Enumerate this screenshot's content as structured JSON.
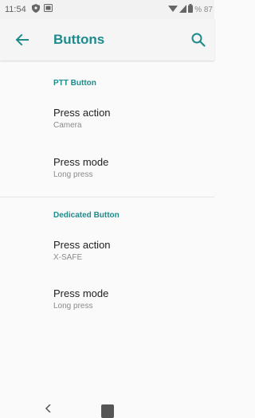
{
  "status": {
    "time": "11:54",
    "battery": "% 87"
  },
  "appbar": {
    "title": "Buttons"
  },
  "sections": [
    {
      "title": "PTT Button",
      "items": [
        {
          "title": "Press action",
          "summary": "Camera"
        },
        {
          "title": "Press mode",
          "summary": "Long press"
        }
      ]
    },
    {
      "title": "Dedicated Button",
      "items": [
        {
          "title": "Press action",
          "summary": "X-SAFE"
        },
        {
          "title": "Press mode",
          "summary": "Long press"
        }
      ]
    }
  ],
  "icons": {
    "back": "arrow-left-icon",
    "search": "search-icon"
  },
  "colors": {
    "accent": "#1e8a8c",
    "text_primary": "#212121",
    "text_secondary": "#8a8a8a",
    "background": "#fafafa"
  }
}
